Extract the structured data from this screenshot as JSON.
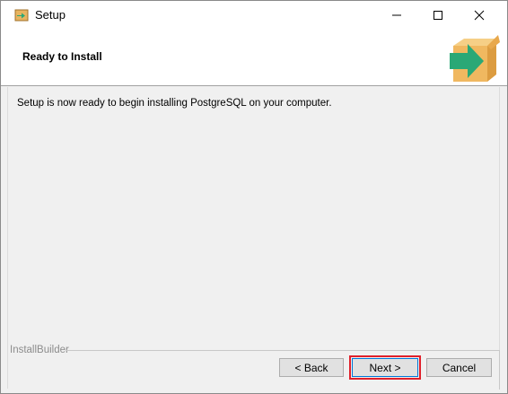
{
  "window": {
    "title": "Setup",
    "controls": [
      "minimize",
      "maximize",
      "close"
    ]
  },
  "header": {
    "title": "Ready to Install",
    "logo_icon": "installer-box-arrow-icon"
  },
  "content": {
    "message": "Setup is now ready to begin installing PostgreSQL on your computer."
  },
  "footer": {
    "group_label": "InstallBuilder",
    "back_label": "< Back",
    "next_label": "Next >",
    "cancel_label": "Cancel"
  },
  "colors": {
    "highlight": "#e0202a",
    "box": "#f0b860",
    "arrow": "#2aa876"
  }
}
